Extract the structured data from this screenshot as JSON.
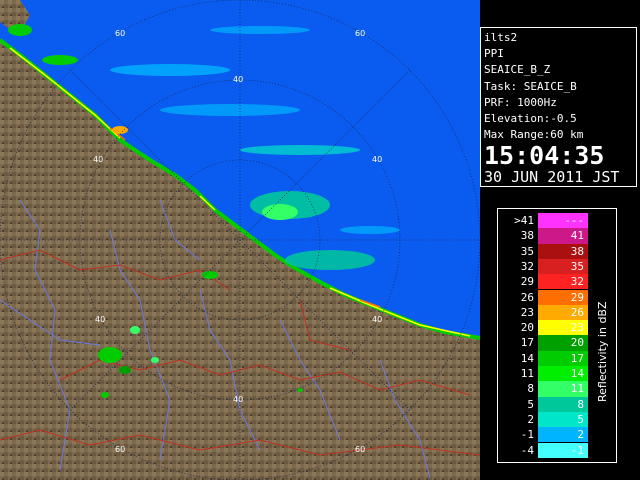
{
  "info_panel": {
    "site": "ilts2",
    "mode": "PPI",
    "product": "SEAICE_B_Z",
    "task": "Task: SEAICE_B",
    "prf": "PRF: 1000Hz",
    "elevation": "Elevation:-0.5",
    "max_range": "Max Range:60 km",
    "time": "15:04:35",
    "date": "30 JUN 2011 JST"
  },
  "range_ring_labels": [
    "60",
    "40",
    "40",
    "40",
    "40",
    "40",
    "40",
    "60",
    "60",
    "60"
  ],
  "legend": {
    "title": "Reflectivity in dBZ",
    "rows": [
      {
        "left": ">41",
        "right": "---",
        "color": "#ff33ff"
      },
      {
        "left": "38",
        "right": "41",
        "color": "#cc1888"
      },
      {
        "left": "35",
        "right": "38",
        "color": "#aa1010"
      },
      {
        "left": "32",
        "right": "35",
        "color": "#d82020"
      },
      {
        "left": "29",
        "right": "32",
        "color": "#ff2222"
      },
      {
        "left": "26",
        "right": "29",
        "color": "#ff6e00"
      },
      {
        "left": "23",
        "right": "26",
        "color": "#ffaa00"
      },
      {
        "left": "20",
        "right": "23",
        "color": "#ffff00"
      },
      {
        "left": "17",
        "right": "20",
        "color": "#00a000"
      },
      {
        "left": "14",
        "right": "17",
        "color": "#00cc00"
      },
      {
        "left": "11",
        "right": "14",
        "color": "#00ee00"
      },
      {
        "left": "8",
        "right": "11",
        "color": "#33ff66"
      },
      {
        "left": "5",
        "right": "8",
        "color": "#00c89a"
      },
      {
        "left": "2",
        "right": "5",
        "color": "#00e6c8"
      },
      {
        "left": "-1",
        "right": "2",
        "color": "#00b4ff"
      },
      {
        "left": "-4",
        "right": "-1",
        "color": "#44ffff"
      }
    ]
  },
  "colors": {
    "sea": "#0a5cf0",
    "land": "#7d6a4e",
    "land_dark": "#5a4a33",
    "rivers": "#6a7ae0",
    "boundaries": "#c03020",
    "grid": "#1a2a5a"
  }
}
